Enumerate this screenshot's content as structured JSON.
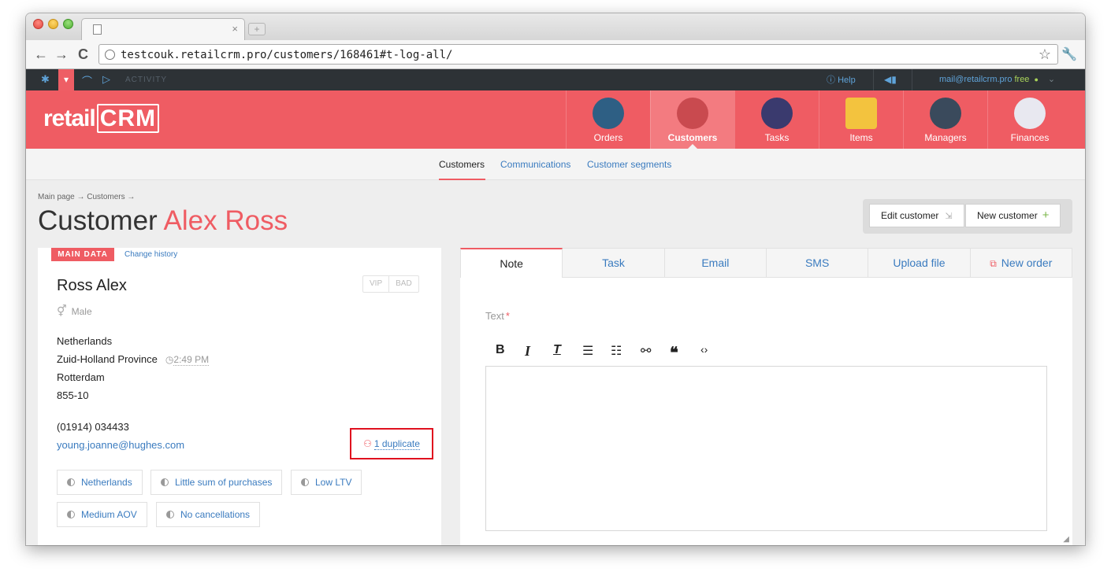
{
  "browser": {
    "tab_close": "×",
    "newtab_plus": "+",
    "url": "testcouk.retailcrm.pro/customers/168461#t-log-all/"
  },
  "appbar": {
    "activity_label": "ACTIVITY",
    "help_label": "Help",
    "account_email": "mail@retailcrm.pro",
    "account_plan": "free"
  },
  "logo": {
    "prefix": "retail",
    "suffix": "CRM"
  },
  "modules": [
    {
      "label": "Orders",
      "color": "#2e5f84",
      "active": false
    },
    {
      "label": "Customers",
      "color": "#c94a4f",
      "active": true
    },
    {
      "label": "Tasks",
      "color": "#3a3a6e",
      "active": false
    },
    {
      "label": "Items",
      "color": "#f3c33e",
      "active": false
    },
    {
      "label": "Managers",
      "color": "#3a4a5c",
      "active": false
    },
    {
      "label": "Finances",
      "color": "#e8e8f0",
      "active": false
    }
  ],
  "subnav": {
    "customers": "Customers",
    "communications": "Communications",
    "segments": "Customer segments"
  },
  "page": {
    "breadcrumb": "Main page → Customers →",
    "title_prefix": "Customer",
    "title_name": "Alex Ross",
    "edit_label": "Edit customer",
    "new_label": "New customer"
  },
  "customer": {
    "badge": "MAIN DATA",
    "change_history": "Change history",
    "name": "Ross Alex",
    "vip": "VIP",
    "bad": "BAD",
    "gender": "Male",
    "country": "Netherlands",
    "region": "Zuid-Holland Province",
    "local_time": "2:49 PM",
    "city": "Rotterdam",
    "postcode": "855-10",
    "phone": "(01914) 034433",
    "email": "young.joanne@hughes.com",
    "duplicates": "1 duplicate",
    "segments": [
      "Netherlands",
      "Little sum of purchases",
      "Low LTV",
      "Medium AOV",
      "No cancellations"
    ]
  },
  "panel": {
    "tabs": [
      "Note",
      "Task",
      "Email",
      "SMS",
      "Upload file",
      "New order"
    ],
    "text_label": "Text",
    "required_mark": "*"
  },
  "colors": {
    "brand_red": "#ef5c63",
    "link_blue": "#3a7bbf",
    "dark_bar": "#2d3236",
    "highlight_box": "#e0101f"
  }
}
